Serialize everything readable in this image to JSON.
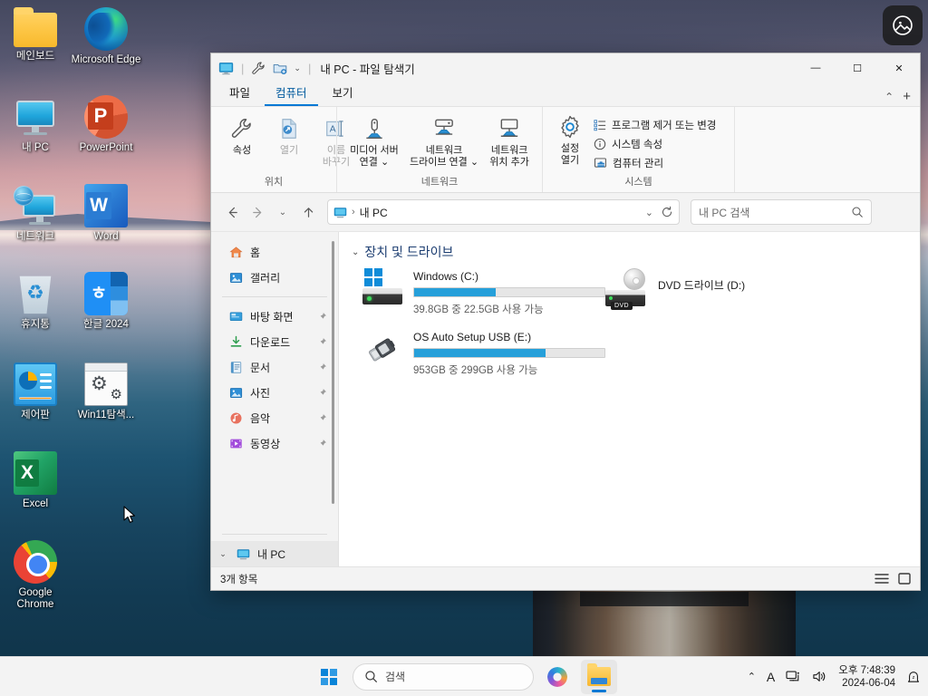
{
  "desktop": {
    "icons": [
      {
        "label": "메인보드",
        "icon": "folder-icon"
      },
      {
        "label": "Microsoft Edge",
        "icon": "edge-icon"
      },
      {
        "label": "내 PC",
        "icon": "this-pc-icon"
      },
      {
        "label": "PowerPoint",
        "icon": "powerpoint-icon"
      },
      {
        "label": "네트워크",
        "icon": "network-icon"
      },
      {
        "label": "Word",
        "icon": "word-icon"
      },
      {
        "label": "휴지통",
        "icon": "recycle-bin-icon"
      },
      {
        "label": "한글 2024",
        "icon": "hangul-icon"
      },
      {
        "label": "제어판",
        "icon": "control-panel-icon"
      },
      {
        "label": "Win11탐색...",
        "icon": "win11-explorer-tool-icon"
      },
      {
        "label": "Excel",
        "icon": "excel-icon"
      },
      {
        "label": "Google Chrome",
        "icon": "chrome-icon"
      }
    ],
    "photo_widget_icon": "photo-widget-icon"
  },
  "explorer": {
    "title": "내 PC - 파일 탐색기",
    "quick_access": [
      {
        "icon": "this-pc-icon"
      },
      {
        "icon": "wrench-icon"
      },
      {
        "icon": "new-folder-icon"
      },
      {
        "icon": "chevron-down-icon"
      }
    ],
    "window_controls": {
      "minimize": "—",
      "maximize": "☐",
      "close": "✕"
    },
    "tabs": [
      {
        "label": "파일",
        "active": false
      },
      {
        "label": "컴퓨터",
        "active": true
      },
      {
        "label": "보기",
        "active": false
      }
    ],
    "ribbon_controls": {
      "collapse": "⌃",
      "add": "+"
    },
    "ribbon": {
      "groups": [
        {
          "name": "위치",
          "buttons": [
            {
              "label_line1": "속성",
              "label_line2": "",
              "icon": "wrench-icon",
              "dimmed": false
            },
            {
              "label_line1": "열기",
              "label_line2": "",
              "icon": "open-file-icon",
              "dimmed": true
            },
            {
              "label_line1": "이름",
              "label_line2": "바꾸기",
              "icon": "rename-icon",
              "dimmed": true
            }
          ]
        },
        {
          "name": "네트워크",
          "buttons": [
            {
              "label_line1": "미디어 서버",
              "label_line2": "연결 ⌄",
              "icon": "media-server-icon",
              "dimmed": false
            },
            {
              "label_line1": "네트워크",
              "label_line2": "드라이브 연결 ⌄",
              "icon": "map-network-drive-icon",
              "dimmed": false
            },
            {
              "label_line1": "네트워크",
              "label_line2": "위치 추가",
              "icon": "add-network-location-icon",
              "dimmed": false
            }
          ]
        },
        {
          "name": "시스템",
          "buttons": [
            {
              "label_line1": "설정",
              "label_line2": "열기",
              "icon": "settings-gear-icon",
              "dimmed": false
            }
          ],
          "list": [
            {
              "label": "프로그램 제거 또는 변경",
              "icon": "uninstall-program-icon"
            },
            {
              "label": "시스템 속성",
              "icon": "info-circle-icon"
            },
            {
              "label": "컴퓨터 관리",
              "icon": "computer-management-icon"
            }
          ]
        }
      ]
    },
    "navbar": {
      "back_icon": "back-arrow-icon",
      "forward_icon": "forward-arrow-icon",
      "recent_icon": "chevron-down-icon",
      "up_icon": "up-arrow-icon",
      "address_path": "내 PC",
      "address_separator": "›",
      "address_dropdown_icon": "chevron-down-icon",
      "refresh_icon": "refresh-icon",
      "search_placeholder": "내 PC 검색",
      "search_icon": "search-icon"
    },
    "sidebar": {
      "items": [
        {
          "label": "홈",
          "icon": "home-icon",
          "pinned": false
        },
        {
          "label": "갤러리",
          "icon": "gallery-icon",
          "pinned": false
        }
      ],
      "pinned_items": [
        {
          "label": "바탕 화면",
          "icon": "desktop-icon",
          "pinned": true
        },
        {
          "label": "다운로드",
          "icon": "downloads-icon",
          "pinned": true
        },
        {
          "label": "문서",
          "icon": "documents-icon",
          "pinned": true
        },
        {
          "label": "사진",
          "icon": "pictures-icon",
          "pinned": true
        },
        {
          "label": "음악",
          "icon": "music-icon",
          "pinned": true
        },
        {
          "label": "동영상",
          "icon": "videos-icon",
          "pinned": true
        }
      ],
      "root": {
        "label": "내 PC",
        "icon": "this-pc-icon",
        "chevron": "⌄"
      },
      "pin_glyph": "📌"
    },
    "content": {
      "group_header": "장치 및 드라이브",
      "group_chevron": "⌄",
      "drives": [
        {
          "name": "Windows (C:)",
          "free_text": "39.8GB 중 22.5GB 사용 가능",
          "used_percent": 43,
          "icon": "windows-drive-icon",
          "has_bar": true
        },
        {
          "name": "DVD 드라이브 (D:)",
          "free_text": "",
          "used_percent": 0,
          "icon": "dvd-drive-icon",
          "has_bar": false,
          "tag": "DVD"
        },
        {
          "name": "OS Auto Setup USB (E:)",
          "free_text": "953GB 중 299GB 사용 가능",
          "used_percent": 69,
          "icon": "usb-drive-icon",
          "has_bar": true
        }
      ]
    },
    "statusbar": {
      "item_count": "3개 항목",
      "view_list_icon": "list-view-icon",
      "view_details_icon": "details-view-icon"
    }
  },
  "taskbar": {
    "start_icon": "windows-start-icon",
    "search_placeholder": "검색",
    "search_icon": "search-icon",
    "copilot_icon": "copilot-icon",
    "explorer_icon": "file-explorer-icon",
    "tray": {
      "overflow_icon": "chevron-up-icon",
      "ime_label": "A",
      "network_icon": "network-tray-icon",
      "volume_icon": "volume-icon",
      "time": "오후 7:48:39",
      "date": "2024-06-04",
      "notification_icon": "notification-bell-icon"
    }
  },
  "colors": {
    "accent": "#0078d4",
    "progress": "#26a0da",
    "group_header": "#1b3c70"
  }
}
